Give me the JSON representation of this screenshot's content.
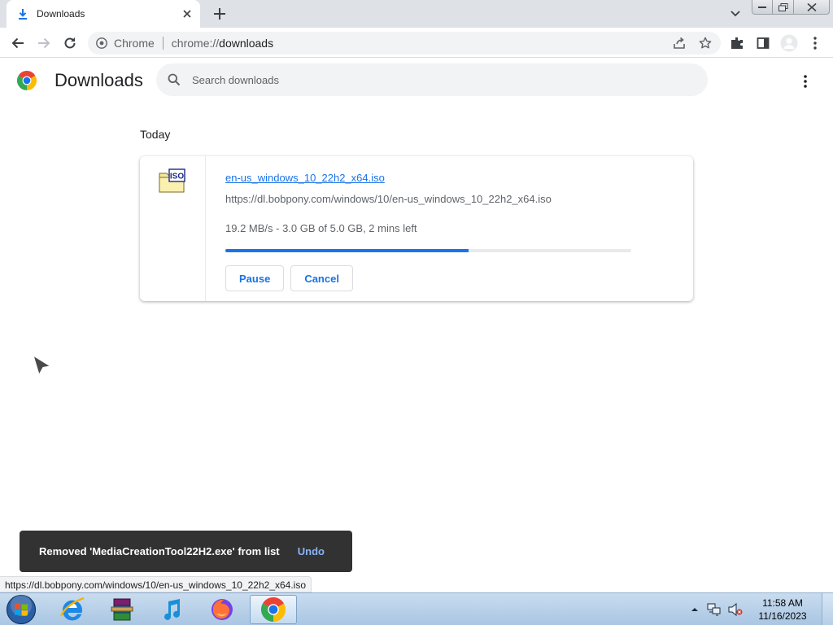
{
  "browser": {
    "tab": {
      "title": "Downloads",
      "icon": "download-icon"
    },
    "omnibox": {
      "chip_label": "Chrome",
      "url_scheme": "chrome://",
      "url_host": "downloads"
    }
  },
  "page": {
    "title": "Downloads",
    "search_placeholder": "Search downloads"
  },
  "downloads": {
    "section_label": "Today",
    "item": {
      "file_name": "en-us_windows_10_22h2_x64.iso",
      "url": "https://dl.bobpony.com/windows/10/en-us_windows_10_22h2_x64.iso",
      "status": "19.2 MB/s - 3.0 GB of 5.0 GB, 2 mins left",
      "progress_fraction": 0.6,
      "pause_label": "Pause",
      "cancel_label": "Cancel",
      "file_type_badge": "ISO"
    }
  },
  "toast": {
    "message": "Removed 'MediaCreationTool22H2.exe' from list",
    "undo_label": "Undo"
  },
  "status_bubble": "https://dl.bobpony.com/windows/10/en-us_windows_10_22h2_x64.iso",
  "taskbar": {
    "clock_time": "11:58 AM",
    "clock_date": "11/16/2023",
    "apps": [
      "internet-explorer",
      "winrar",
      "itunes",
      "firefox",
      "chrome"
    ]
  },
  "colors": {
    "accent": "#1a73e8",
    "toast_bg": "#323232",
    "undo": "#8ab4f8"
  }
}
